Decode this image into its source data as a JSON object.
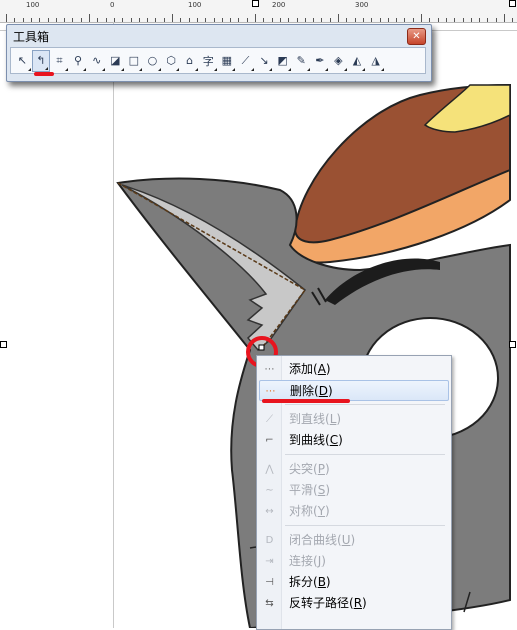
{
  "ruler": {
    "labels": [
      "100",
      "0",
      "100",
      "200",
      "300"
    ]
  },
  "toolbox": {
    "title": "工具箱",
    "close_glyph": "✕",
    "tools": [
      {
        "name": "pick-tool-icon",
        "glyph": "↖"
      },
      {
        "name": "shape-tool-icon",
        "glyph": "↰"
      },
      {
        "name": "crop-tool-icon",
        "glyph": "⌗"
      },
      {
        "name": "zoom-tool-icon",
        "glyph": "⚲"
      },
      {
        "name": "freehand-tool-icon",
        "glyph": "∿"
      },
      {
        "name": "smart-fill-tool-icon",
        "glyph": "◪"
      },
      {
        "name": "rectangle-tool-icon",
        "glyph": "□"
      },
      {
        "name": "ellipse-tool-icon",
        "glyph": "○"
      },
      {
        "name": "polygon-tool-icon",
        "glyph": "⬡"
      },
      {
        "name": "basic-shapes-tool-icon",
        "glyph": "⌂"
      },
      {
        "name": "text-tool-icon",
        "glyph": "字"
      },
      {
        "name": "table-tool-icon",
        "glyph": "▦"
      },
      {
        "name": "dimension-tool-icon",
        "glyph": "⟋"
      },
      {
        "name": "connector-tool-icon",
        "glyph": "↘"
      },
      {
        "name": "blend-tool-icon",
        "glyph": "◩"
      },
      {
        "name": "eyedropper-tool-icon",
        "glyph": "✎"
      },
      {
        "name": "outline-tool-icon",
        "glyph": "✒"
      },
      {
        "name": "fill-tool-icon",
        "glyph": "◈"
      },
      {
        "name": "interactive-fill-tool-icon",
        "glyph": "◭"
      },
      {
        "name": "mesh-fill-tool-icon",
        "glyph": "◮"
      }
    ]
  },
  "context_menu": {
    "items": [
      {
        "label": "添加",
        "key": "A",
        "enabled": true,
        "icon": "add-node-icon",
        "glyph": "⋯"
      },
      {
        "label": "删除",
        "key": "D",
        "enabled": true,
        "icon": "delete-node-icon",
        "glyph": "⋯",
        "highlighted": true
      },
      {
        "label": "到直线",
        "key": "L",
        "enabled": false,
        "icon": "to-line-icon",
        "glyph": "⟋"
      },
      {
        "label": "到曲线",
        "key": "C",
        "enabled": true,
        "icon": "to-curve-icon",
        "glyph": "⌐"
      },
      {
        "label": "尖突",
        "key": "P",
        "enabled": false,
        "icon": "cusp-icon",
        "glyph": "⋀"
      },
      {
        "label": "平滑",
        "key": "S",
        "enabled": false,
        "icon": "smooth-icon",
        "glyph": "∼"
      },
      {
        "label": "对称",
        "key": "Y",
        "enabled": false,
        "icon": "symmetrical-icon",
        "glyph": "↔"
      },
      {
        "label": "闭合曲线",
        "key": "U",
        "enabled": false,
        "icon": "close-curve-icon",
        "glyph": "D"
      },
      {
        "label": "连接",
        "key": "J",
        "enabled": false,
        "icon": "join-icon",
        "glyph": "⇥"
      },
      {
        "label": "拆分",
        "key": "B",
        "enabled": true,
        "icon": "break-apart-icon",
        "glyph": "⊣"
      },
      {
        "label": "反转子路径",
        "key": "R",
        "enabled": true,
        "icon": "reverse-subpath-icon",
        "glyph": "⇆"
      }
    ]
  }
}
